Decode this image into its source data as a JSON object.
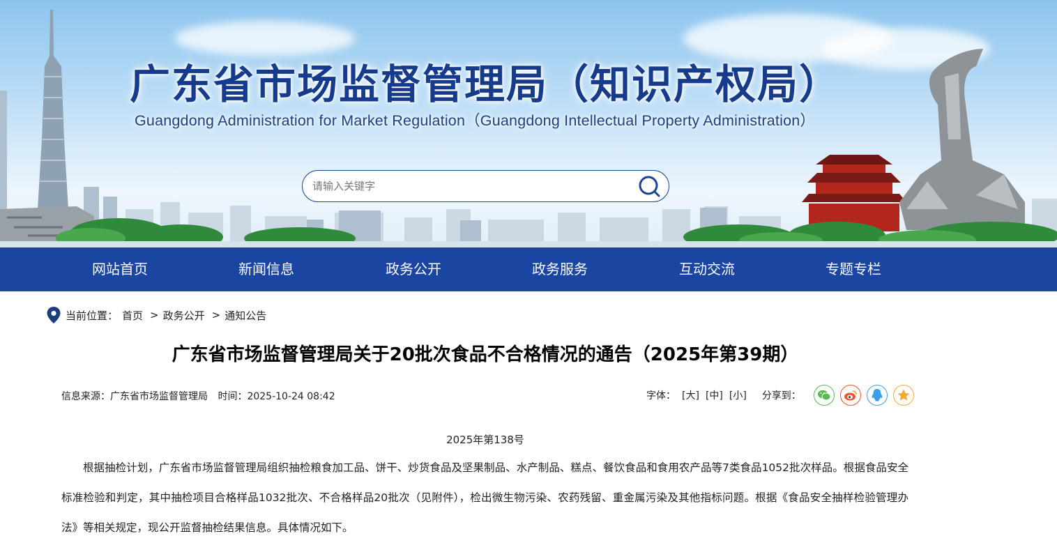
{
  "header": {
    "title": "广东省市场监督管理局（知识产权局）",
    "subtitle": "Guangdong Administration for Market Regulation（Guangdong Intellectual Property Administration）",
    "search": {
      "placeholder": "请输入关键字"
    }
  },
  "nav": {
    "items": [
      {
        "label": "网站首页"
      },
      {
        "label": "新闻信息"
      },
      {
        "label": "政务公开"
      },
      {
        "label": "政务服务"
      },
      {
        "label": "互动交流"
      },
      {
        "label": "专题专栏"
      }
    ]
  },
  "breadcrumb": {
    "prefix": "当前位置：",
    "items": [
      "首页",
      "政务公开",
      "通知公告"
    ],
    "separator": ">"
  },
  "article": {
    "title": "广东省市场监督管理局关于20批次食品不合格情况的通告（2025年第39期）",
    "source": "信息来源：广东省市场监督管理局",
    "time": "时间：2025-10-24 08:42",
    "font_size_label": "字体：",
    "font_sizes": [
      "[大]",
      "[中]",
      "[小]"
    ],
    "share_label": "分享到：",
    "share_targets": [
      {
        "icon": "wechat-icon",
        "color": "#5ab854"
      },
      {
        "icon": "weibo-icon",
        "color": "#e8542e"
      },
      {
        "icon": "qq-icon",
        "color": "#3c9ee5"
      },
      {
        "icon": "qzone-icon",
        "color": "#f3a833"
      }
    ],
    "doc_number": "2025年第138号",
    "body": "根据抽检计划，广东省市场监督管理局组织抽检粮食加工品、饼干、炒货食品及坚果制品、水产制品、糕点、餐饮食品和食用农产品等7类食品1052批次样品。根据食品安全标准检验和判定，其中抽检项目合格样品1032批次、不合格样品20批次（见附件），检出微生物污染、农药残留、重金属污染及其他指标问题。根据《食品安全抽样检验管理办法》等相关规定，现公开监督抽检结果信息。具体情况如下。"
  },
  "colors": {
    "nav_bg": "#1a45a0",
    "title_blue": "#163b8c"
  }
}
